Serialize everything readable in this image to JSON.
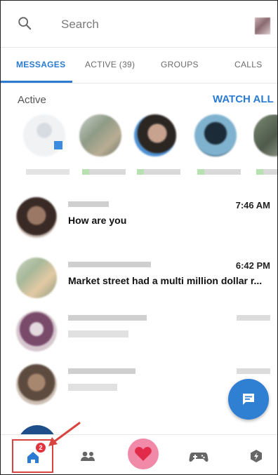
{
  "search": {
    "placeholder": "Search",
    "icon": "search-icon"
  },
  "tabs": [
    {
      "label": "MESSAGES",
      "active": true
    },
    {
      "label": "ACTIVE (39)",
      "active": false
    },
    {
      "label": "GROUPS",
      "active": false
    },
    {
      "label": "CALLS",
      "active": false
    }
  ],
  "active_section": {
    "label": "Active",
    "action": "WATCH ALL"
  },
  "conversations": [
    {
      "time": "7:46 AM",
      "message": "How are you"
    },
    {
      "time": "6:42 PM",
      "message": "Market street had a multi million dollar r..."
    },
    {
      "time": "",
      "message": ""
    },
    {
      "time": "",
      "message": ""
    }
  ],
  "bottom_nav": {
    "items": [
      "home-icon",
      "people-icon",
      "heart-icon",
      "gamepad-icon",
      "discover-icon"
    ],
    "home_badge": "2"
  },
  "colors": {
    "accent": "#2a7bd1",
    "fab": "#2f7fd3",
    "heart_bg": "#f08aa8",
    "heart": "#e22a4a",
    "annotation": "#d9443f",
    "badge": "#e0343e"
  }
}
